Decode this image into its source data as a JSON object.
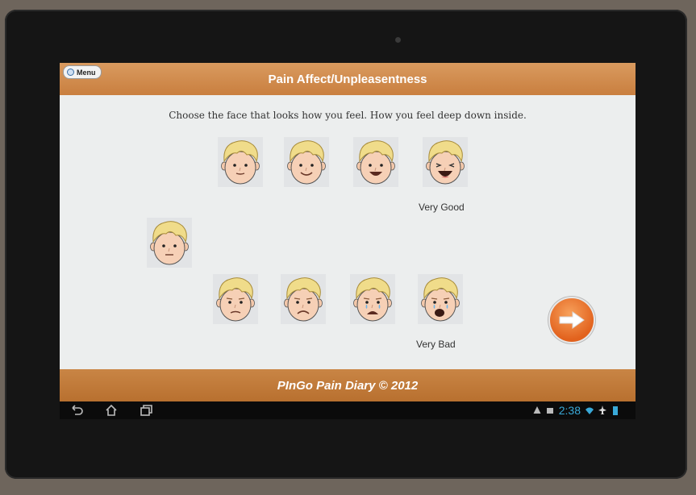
{
  "header": {
    "title": "Pain Affect/Unpleasentness",
    "menu_label": "Menu"
  },
  "instruction": "Choose the face that looks how you feel. How you feel deep down inside.",
  "faces": {
    "good_labels": {
      "end": "Very Good"
    },
    "bad_labels": {
      "end": "Very Bad"
    }
  },
  "footer": {
    "text": "PInGo Pain Diary © 2012"
  },
  "system_bar": {
    "time": "2:38"
  },
  "colors": {
    "accent": "#d28b4b",
    "clock": "#39a9d8",
    "next_button": "#e8722c"
  },
  "icons": [
    "menu-icon",
    "back-icon",
    "home-icon",
    "recent-apps-icon",
    "warning-icon",
    "notification-icon",
    "wifi-icon",
    "airplane-icon",
    "battery-icon",
    "arrow-right-icon"
  ]
}
